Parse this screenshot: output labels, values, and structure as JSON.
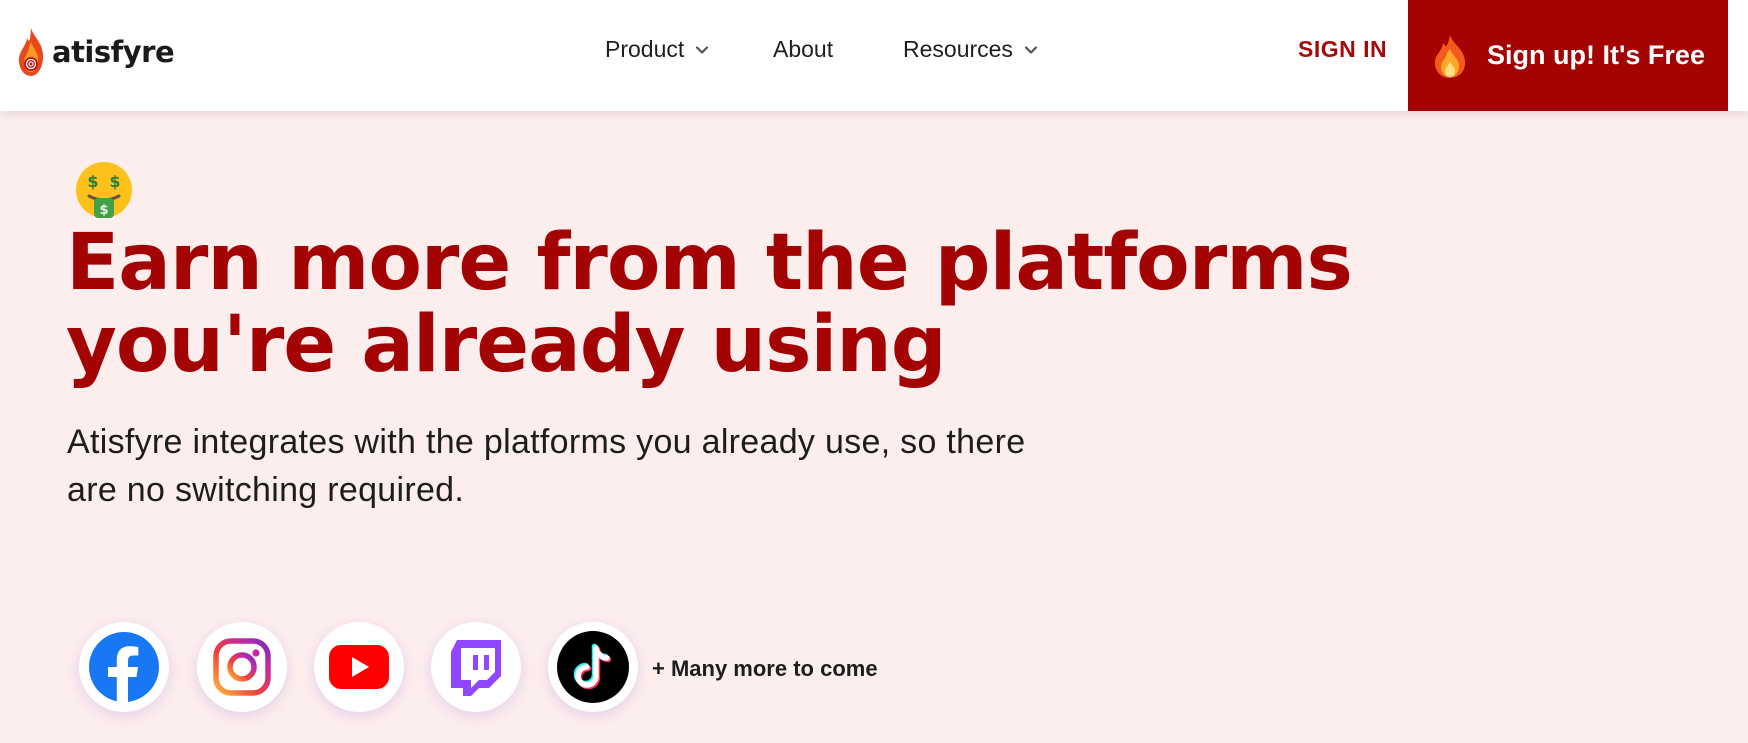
{
  "header": {
    "brand": "atisfyre",
    "nav": [
      {
        "label": "Product",
        "has_dropdown": true
      },
      {
        "label": "About",
        "has_dropdown": false
      },
      {
        "label": "Resources",
        "has_dropdown": true
      }
    ],
    "signin_label": "SIGN IN",
    "signup_label": "Sign up! It's Free"
  },
  "hero": {
    "emoji_icon": "money-mouth-face-icon",
    "headline_lines": [
      "Earn more from the platforms",
      "you're already using"
    ],
    "subtext_lines": [
      "Atisfyre integrates with the platforms you already use, so there",
      "are no switching required."
    ]
  },
  "platforms": {
    "icons": [
      "facebook-icon",
      "instagram-icon",
      "youtube-icon",
      "twitch-icon",
      "tiktok-icon"
    ],
    "more_label": "+ Many more to come"
  },
  "colors": {
    "brand_red": "#a30303",
    "hero_bg": "#fdeeee",
    "text_dark": "#1d1d1d"
  }
}
